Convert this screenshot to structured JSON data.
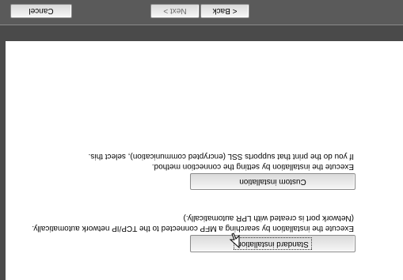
{
  "options": {
    "standard": {
      "label": "Standard installation",
      "description_line1": "Execute the installation by searching a MFP connected to the TCP/IP network automatically.",
      "description_line2": "(Network port is created with LPR automatically.)"
    },
    "custom": {
      "label": "Custom installation",
      "description_line1": "Execute the installation by setting the connection method.",
      "description_line2": "If you do the print that supports SSL (encrypted communication), select this."
    }
  },
  "buttons": {
    "back": "< Back",
    "next": "Next >",
    "cancel": "Cancel"
  }
}
